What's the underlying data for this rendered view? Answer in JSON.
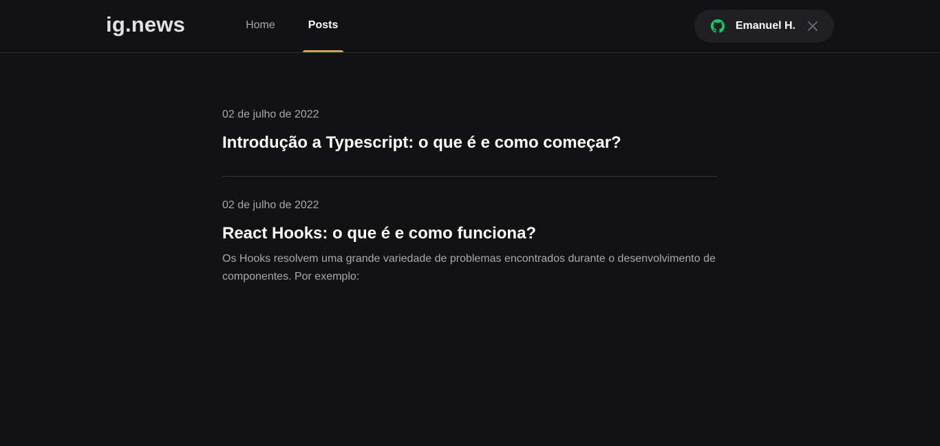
{
  "header": {
    "logo": "ig.news",
    "nav": [
      {
        "label": "Home",
        "active": false
      },
      {
        "label": "Posts",
        "active": true
      }
    ],
    "user_button": {
      "name": "Emanuel H.",
      "icon": "github-icon",
      "close_icon": "close-icon"
    }
  },
  "colors": {
    "background": "#121214",
    "accent": "#eba417",
    "github_green": "#04d361"
  },
  "posts": [
    {
      "date": "02 de julho de 2022",
      "title": "Introdução a Typescript: o que é e como começar?",
      "excerpt": ""
    },
    {
      "date": "02 de julho de 2022",
      "title": "React Hooks: o que é e como funciona?",
      "excerpt": "Os Hooks resolvem uma grande variedade de problemas encontrados durante o desenvolvimento de componentes. Por exemplo:"
    }
  ]
}
